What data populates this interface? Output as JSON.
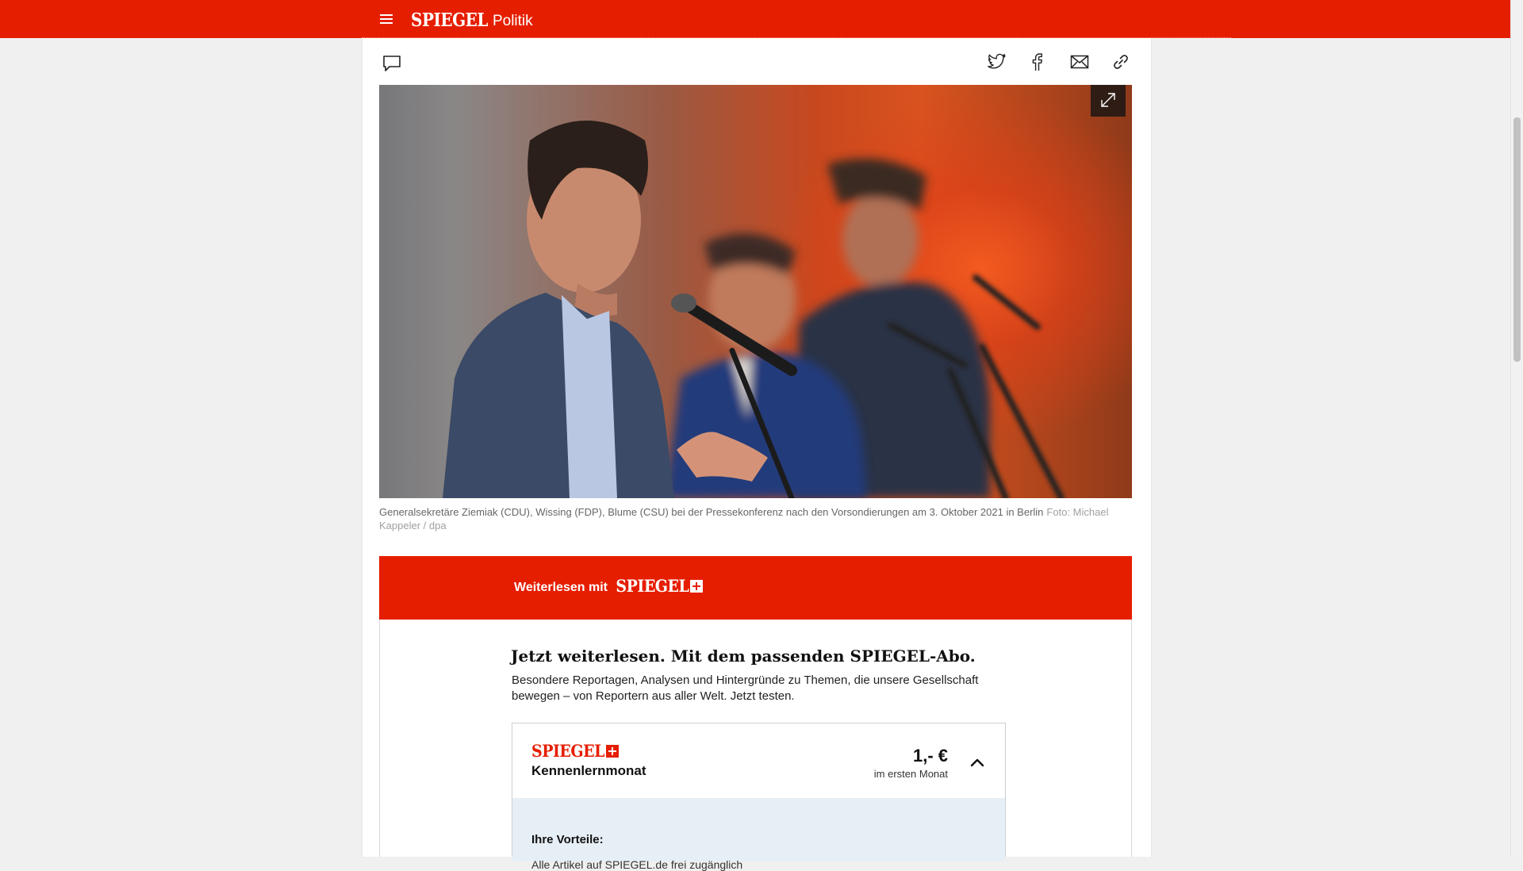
{
  "header": {
    "logo": "SPIEGEL",
    "section": "Politik",
    "menu_icon": "hamburger-menu-icon",
    "background_color": "#e61e00"
  },
  "toolbar": {
    "comment_icon": "comment-icon",
    "share_icons": [
      "twitter-icon",
      "facebook-icon",
      "mail-icon",
      "link-icon"
    ]
  },
  "article": {
    "image_alt": "",
    "expand_icon": "expand-icon",
    "caption": "Generalsekretäre Ziemiak (CDU), Wissing (FDP), Blume (CSU) bei der Pressekonferenz nach den Vorsondierungen am 3. Oktober 2021 in Berlin",
    "credit": "Foto: Michael Kappeler / dpa"
  },
  "paywall": {
    "banner_label": "Weiterlesen mit",
    "banner_logo": "SPIEGEL",
    "headline": "Jetzt weiterlesen. Mit dem passenden SPIEGEL-Abo.",
    "intro": "Besondere Reportagen, Analysen und Hintergründe zu Themen, die unsere Gesellschaft bewegen – von Reportern aus aller Welt. Jetzt testen.",
    "offer": {
      "logo": "SPIEGEL",
      "plan": "Kennenlernmonat",
      "price": "1,- €",
      "price_note": "im ersten Monat",
      "benefits_title": "Ihre Vorteile:",
      "benefits": [
        "Alle Artikel auf SPIEGEL.de frei zugänglich"
      ]
    }
  }
}
